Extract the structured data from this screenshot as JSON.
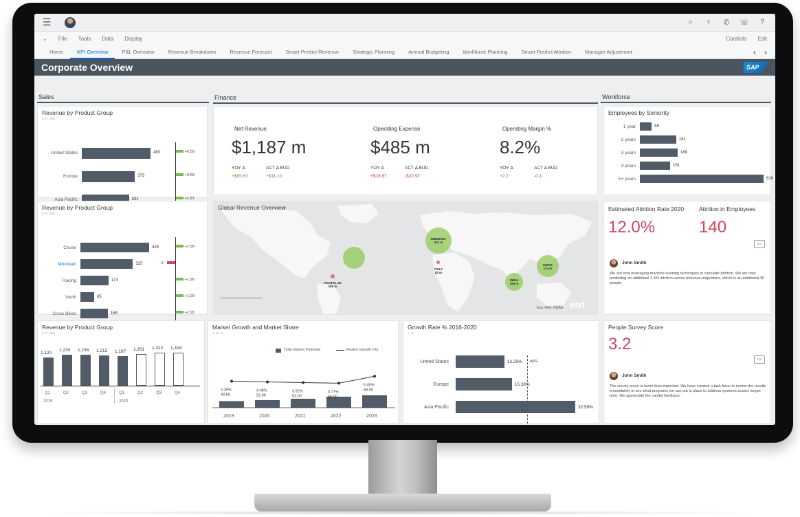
{
  "shell": {
    "menu": [
      "File",
      "Tools",
      "Data",
      "Display"
    ],
    "menu_right": [
      "Controls",
      "Edit"
    ]
  },
  "tabs": [
    "Home",
    "KPI Overview",
    "P&L Overview",
    "Revenue Breakdown",
    "Revenue Forecast",
    "Smart Predict Revenue",
    "Strategic Planning",
    "Annual Budgeting",
    "Workforce Planning",
    "Smart Predict Attrition",
    "Manager Adjustment"
  ],
  "active_tab": "KPI Overview",
  "page_title": "Corporate Overview",
  "brand": "SAP",
  "sections": {
    "sales": "Sales",
    "finance": "Finance",
    "workforce": "Workforce"
  },
  "rev_group_1": {
    "title": "Revenue by Product Group",
    "unit": "in m USD",
    "rows": [
      {
        "label": "United States",
        "value": "483",
        "delta": "+0.59"
      },
      {
        "label": "Europe",
        "value": "373",
        "delta": "+0.59"
      },
      {
        "label": "Asia Pacific",
        "value": "331",
        "delta": "+1.87"
      }
    ]
  },
  "finance_kpis": [
    {
      "label": "Net Revenue",
      "value": "$1,187 m",
      "yoy_label": "YOY Δ",
      "act_label": "ACT Δ BUD",
      "yoy": "+$65.63",
      "act": "+$11.10",
      "yoy_cls": "pos",
      "act_cls": "pos"
    },
    {
      "label": "Operating Expense",
      "value": "$485 m",
      "yoy_label": "YOY Δ",
      "act_label": "ACT Δ BUD",
      "yoy": "+$19.67",
      "act": "-$22.97",
      "yoy_cls": "neg",
      "act_cls": "neg"
    },
    {
      "label": "Operating Margin %",
      "value": "8.2%",
      "yoy_label": "YOY Δ",
      "act_label": "ACT Δ BUD",
      "yoy": "+2.2",
      "act": "-0.1",
      "yoy_cls": "pos",
      "act_cls": "neg"
    }
  ],
  "employees": {
    "title": "Employees by Seniority",
    "rows": [
      {
        "label": "1 year",
        "value": "59"
      },
      {
        "label": "2 years",
        "value": "181"
      },
      {
        "label": "3 years",
        "value": "188"
      },
      {
        "label": "4 years",
        "value": "151"
      },
      {
        "label": "5+ years",
        "value": "616"
      }
    ]
  },
  "rev_group_2": {
    "title": "Revenue by Product Group",
    "unit": "in m USD",
    "rows": [
      {
        "label": "Cruise",
        "value": "425",
        "delta": "+1.90"
      },
      {
        "label": "Mountain",
        "value": "325",
        "delta": "-2"
      },
      {
        "label": "Racing",
        "value": "173",
        "delta": "+1.90"
      },
      {
        "label": "Youth",
        "value": "85",
        "delta": "+1.90"
      },
      {
        "label": "Cross Bikes",
        "value": "169",
        "delta": "+1.90"
      }
    ]
  },
  "map": {
    "title": "Global Revenue Overview",
    "labels": [
      {
        "name": "GERMANY",
        "value": "213 m"
      },
      {
        "name": "ITALY",
        "value": "$2 m"
      },
      {
        "name": "PACIFIC US",
        "value": "106 m"
      },
      {
        "name": "CHINA",
        "value": "174 m"
      },
      {
        "name": "INDIA",
        "value": "154 m"
      }
    ],
    "attribution": "Esri, FAO, NOAA",
    "logo": "esri"
  },
  "attrition": {
    "rate_label": "Estimated Attrition Rate 2020",
    "rate": "12.0%",
    "count_label": "Attrition in Employees",
    "count": "140",
    "author": "John Smith",
    "comment": "We are now leveraging machine learning techniques to calculate attrition. We are now predicting an additional 2.4% attrition versus previous projections, which is an additional 30 people."
  },
  "quarterly": {
    "title": "Revenue by Product Group",
    "unit": "in m USD",
    "quarters": [
      "Q1",
      "Q2",
      "Q3",
      "Q4",
      "Q1",
      "Q2",
      "Q3",
      "Q4"
    ],
    "years": [
      "2019",
      "2020"
    ],
    "values": [
      "1,120",
      "1,230",
      "1,238",
      "1,212",
      "1,187",
      "1,261",
      "1,322",
      "1,318"
    ]
  },
  "market": {
    "title": "Market Growth and Market Share",
    "unit": "in bn, %",
    "legend_bar": "Total Market Potential",
    "legend_line": "Market Growth (%)",
    "years": [
      "2019",
      "2020",
      "2021",
      "2022",
      "2023"
    ],
    "growth": [
      "4.26%",
      "4.08%",
      "3.92%",
      "3.77%",
      "5.45%"
    ],
    "potential": [
      "49.60",
      "51.00",
      "53.00",
      "56.00",
      "58.00"
    ]
  },
  "growth_rate": {
    "title": "Growth Rate % 2016-2020",
    "unit": "in %",
    "avg_label": "AVG",
    "rows": [
      {
        "label": "United States",
        "value": "13.25%"
      },
      {
        "label": "Europe",
        "value": "15.28%"
      },
      {
        "label": "Asia Pacific",
        "value": "32.59%"
      }
    ]
  },
  "survey": {
    "title": "People Survey Score",
    "score": "3.2",
    "author": "John Smith",
    "comment": "The survey score is lower than expected. We have created a task force to review the results immediately to see what programs we can put in place to address systemic issues longer term. We appreciate the candid feedback."
  },
  "chart_data": [
    {
      "type": "bar",
      "title": "Revenue by Product Group",
      "categories": [
        "United States",
        "Europe",
        "Asia Pacific"
      ],
      "values": [
        483,
        373,
        331
      ]
    },
    {
      "type": "bar",
      "title": "Employees by Seniority",
      "categories": [
        "1 year",
        "2 years",
        "3 years",
        "4 years",
        "5+ years"
      ],
      "values": [
        59,
        181,
        188,
        151,
        616
      ]
    },
    {
      "type": "bar",
      "title": "Revenue by Product Group",
      "categories": [
        "Cruise",
        "Mountain",
        "Racing",
        "Youth",
        "Cross Bikes"
      ],
      "values": [
        425,
        325,
        173,
        85,
        169
      ]
    },
    {
      "type": "bar",
      "title": "Revenue by Product Group",
      "categories": [
        "Q1 2019",
        "Q2 2019",
        "Q3 2019",
        "Q4 2019",
        "Q1 2020",
        "Q2 2020",
        "Q3 2020",
        "Q4 2020"
      ],
      "values": [
        1120,
        1230,
        1238,
        1212,
        1187,
        1261,
        1322,
        1318
      ]
    },
    {
      "type": "bar",
      "title": "Market Growth and Market Share",
      "categories": [
        "2019",
        "2020",
        "2021",
        "2022",
        "2023"
      ],
      "series": [
        {
          "name": "Total Market Potential",
          "values": [
            49.6,
            51,
            53,
            56,
            58
          ]
        },
        {
          "name": "Market Growth (%)",
          "values": [
            4.26,
            4.08,
            3.92,
            3.77,
            5.45
          ]
        }
      ]
    },
    {
      "type": "bar",
      "title": "Growth Rate % 2016-2020",
      "categories": [
        "United States",
        "Europe",
        "Asia Pacific"
      ],
      "values": [
        13.25,
        15.28,
        32.59
      ]
    }
  ]
}
